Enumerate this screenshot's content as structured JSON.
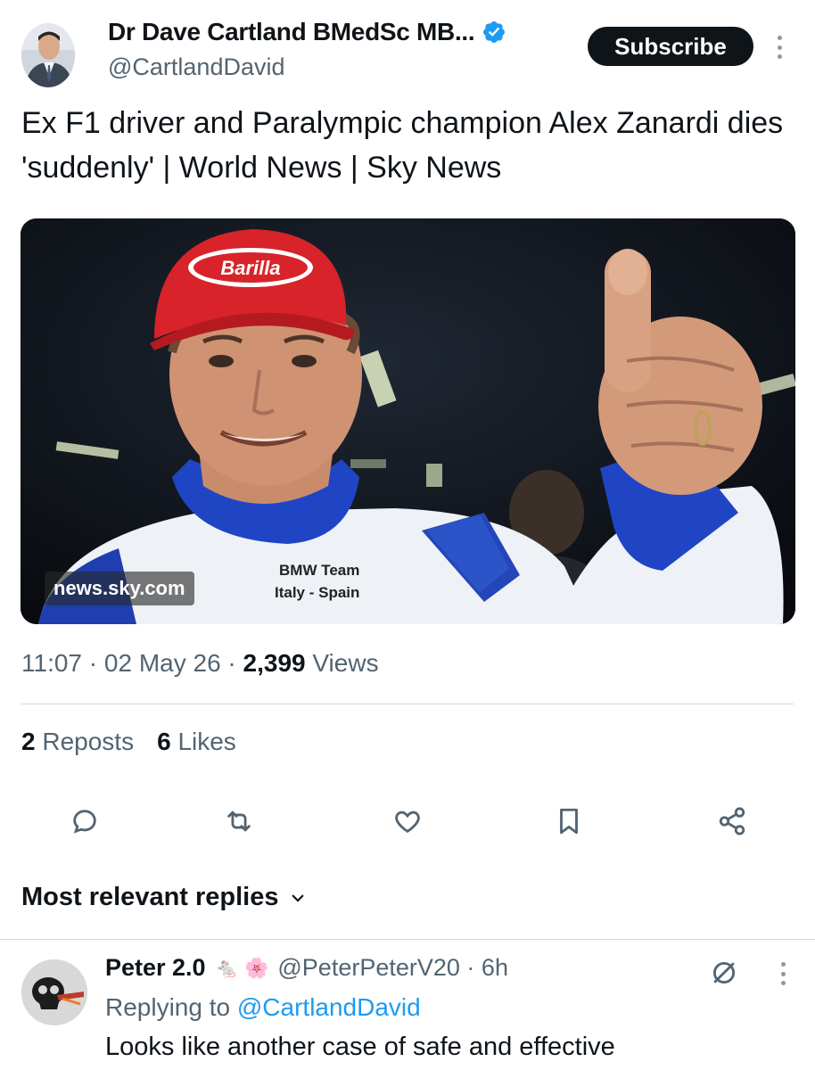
{
  "author": {
    "display_name": "Dr Dave Cartland BMedSc MB...",
    "handle": "@CartlandDavid",
    "verified": true,
    "subscribe_label": "Subscribe"
  },
  "tweet": {
    "text": "Ex F1 driver and Paralympic champion Alex Zanardi dies 'suddenly' | World News | Sky News",
    "media_source": "news.sky.com",
    "media_cap_text": "Barilla",
    "media_suit_text": [
      "BMW Team",
      "Italy - Spain"
    ],
    "time": "11:07",
    "date": "02 May 26",
    "views_count": "2,399",
    "views_label": "Views",
    "reposts_count": "2",
    "reposts_label": "Reposts",
    "likes_count": "6",
    "likes_label": "Likes"
  },
  "actions": [
    "reply-icon",
    "repost-icon",
    "like-icon",
    "bookmark-icon",
    "share-icon"
  ],
  "replies": {
    "heading": "Most relevant replies",
    "items": [
      {
        "name": "Peter 2.0",
        "emojis": [
          "🐁",
          "🌸"
        ],
        "handle": "@PeterPeterV20",
        "age": "6h",
        "replying_prefix": "Replying to",
        "replying_to": "@CartlandDavid",
        "text": "Looks like another case of safe and effective"
      }
    ]
  },
  "colors": {
    "text": "#0f1419",
    "muted": "#536471",
    "accent": "#1d9bf0",
    "divider": "#cfd9de",
    "subscribe_bg": "#0f1419"
  }
}
